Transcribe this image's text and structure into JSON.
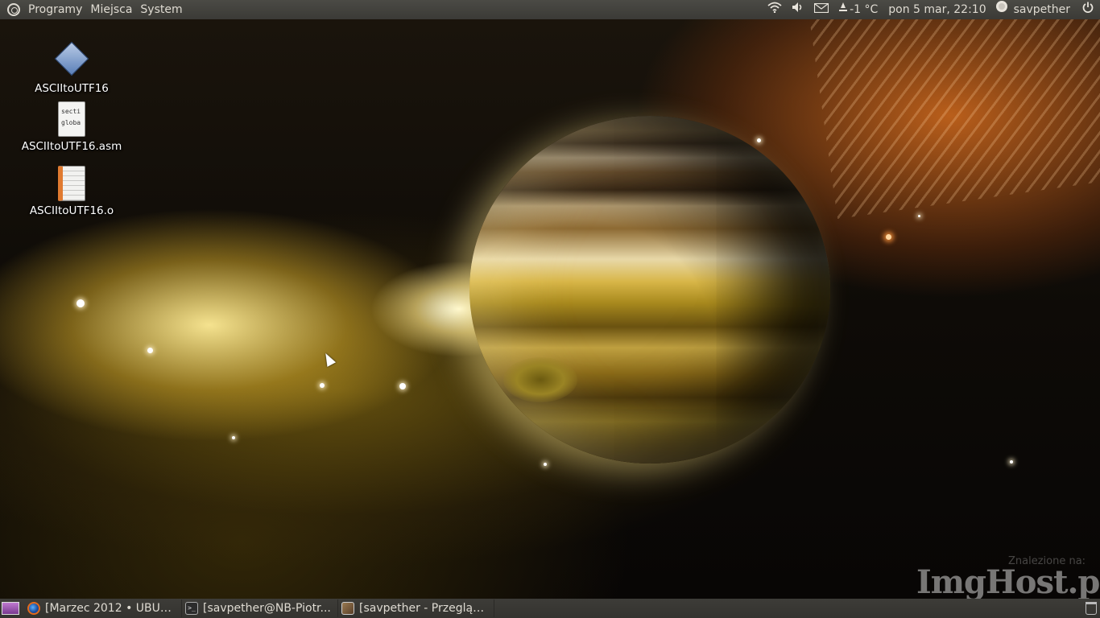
{
  "top_panel": {
    "menus": [
      "Programy",
      "Miejsca",
      "System"
    ],
    "temperature": "-1 °C",
    "datetime": "pon  5 mar, 22:10",
    "username": "savpether"
  },
  "desktop_icons": [
    {
      "label": "ASCIItoUTF16",
      "icon": "executable-icon"
    },
    {
      "label": "ASCIItoUTF16.asm",
      "icon": "text-file-icon",
      "preview": [
        "secti",
        "globa"
      ]
    },
    {
      "label": "ASCIItoUTF16.o",
      "icon": "object-file-icon"
    }
  ],
  "taskbar": {
    "tasks": [
      {
        "label": "[Marzec 2012 • UBUN...",
        "icon": "firefox-icon"
      },
      {
        "label": "[savpether@NB-Piotr...",
        "icon": "terminal-icon"
      },
      {
        "label": "[savpether - Przegląd...",
        "icon": "image-viewer-icon"
      }
    ]
  },
  "watermark": {
    "text": "ImgHost.pl",
    "subtext": "Znalezione na:"
  }
}
